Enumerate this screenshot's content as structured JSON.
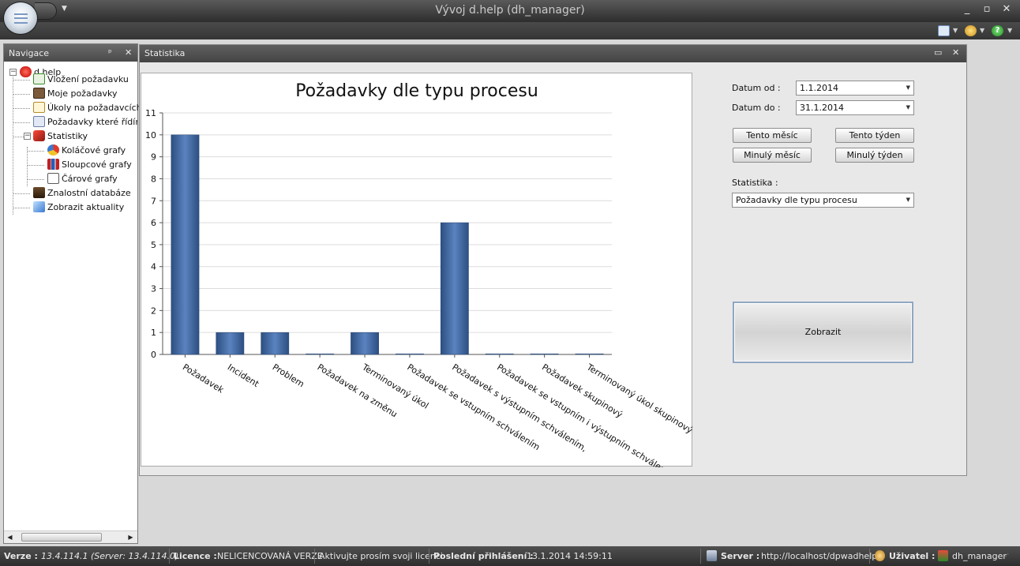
{
  "window": {
    "title": "Vývoj d.help (dh_manager)",
    "min": "_",
    "max": "▫",
    "close": "✕"
  },
  "colors": {
    "bar": "#3a5f93",
    "title_bar": "#2d2d2d",
    "panel_header": "#555555",
    "accent_border": "#8fa7c3"
  },
  "ribbon_icons": [
    "calendar-icon",
    "theme-icon",
    "help-icon"
  ],
  "nav": {
    "header": "Navigace",
    "pin": "ᵖ",
    "close": "✕",
    "root": "d.help",
    "items": [
      {
        "label": "Vložení požadavku",
        "icon": "add-request-icon"
      },
      {
        "label": "Moje požadavky",
        "icon": "my-requests-icon"
      },
      {
        "label": "Úkoly na požadavcích",
        "icon": "tasks-icon"
      },
      {
        "label": "Požadavky které řídím",
        "icon": "managed-requests-icon"
      },
      {
        "label": "Statistiky",
        "icon": "statistics-icon"
      },
      {
        "label": "Koláčové grafy",
        "icon": "pie-chart-icon"
      },
      {
        "label": "Sloupcové grafy",
        "icon": "bar-chart-icon"
      },
      {
        "label": "Čárové grafy",
        "icon": "line-chart-icon"
      },
      {
        "label": "Znalostní databáze",
        "icon": "knowledge-base-icon"
      },
      {
        "label": "Zobrazit aktuality",
        "icon": "news-icon"
      }
    ]
  },
  "doc": {
    "title": "Statistika",
    "restore": "▭",
    "close": "✕"
  },
  "form": {
    "date_from_label": "Datum od :",
    "date_from_value": "1.1.2014",
    "date_to_label": "Datum do :",
    "date_to_value": "31.1.2014",
    "this_month": "Tento měsíc",
    "this_week": "Tento týden",
    "last_month": "Minulý měsíc",
    "last_week": "Minulý týden",
    "stat_label": "Statistika :",
    "stat_value": "Požadavky dle typu procesu",
    "show": "Zobrazit"
  },
  "chart_data": {
    "type": "bar",
    "title": "Požadavky dle typu procesu",
    "xlabel": "",
    "ylabel": "",
    "ylim": [
      0,
      11
    ],
    "yticks": [
      0,
      1,
      2,
      3,
      4,
      5,
      6,
      7,
      8,
      9,
      10,
      11
    ],
    "grid": true,
    "legend": "none",
    "categories": [
      "Požadavek",
      "Incident",
      "Problem",
      "Požadavek na změnu",
      "Terminovaný úkol",
      "Požadavek se vstupním schválením",
      "Požadavek s výstupním schválením,",
      "Požadavek se vstupním i výstupním schválením",
      "Požadavek skupinový",
      "Terminovaný úkol skupinový"
    ],
    "values": [
      10,
      1,
      1,
      0,
      1,
      0,
      6,
      0,
      0,
      0
    ]
  },
  "status": {
    "version_label": "Verze :",
    "version_value": "13.4.114.1 (Server: 13.4.114.0)",
    "licence_label": "Licence :",
    "licence_value": "NELICENCOVANÁ VERZE",
    "activate": "Aktivujte prosím svoji licenci",
    "last_login_label": "Poslední přihlášení :",
    "last_login_value": "13.1.2014 14:59:11",
    "server_label": "Server :",
    "server_value": "http://localhost/dpwadhelp",
    "user_label": "Uživatel :",
    "user_value": "dh_manager"
  }
}
